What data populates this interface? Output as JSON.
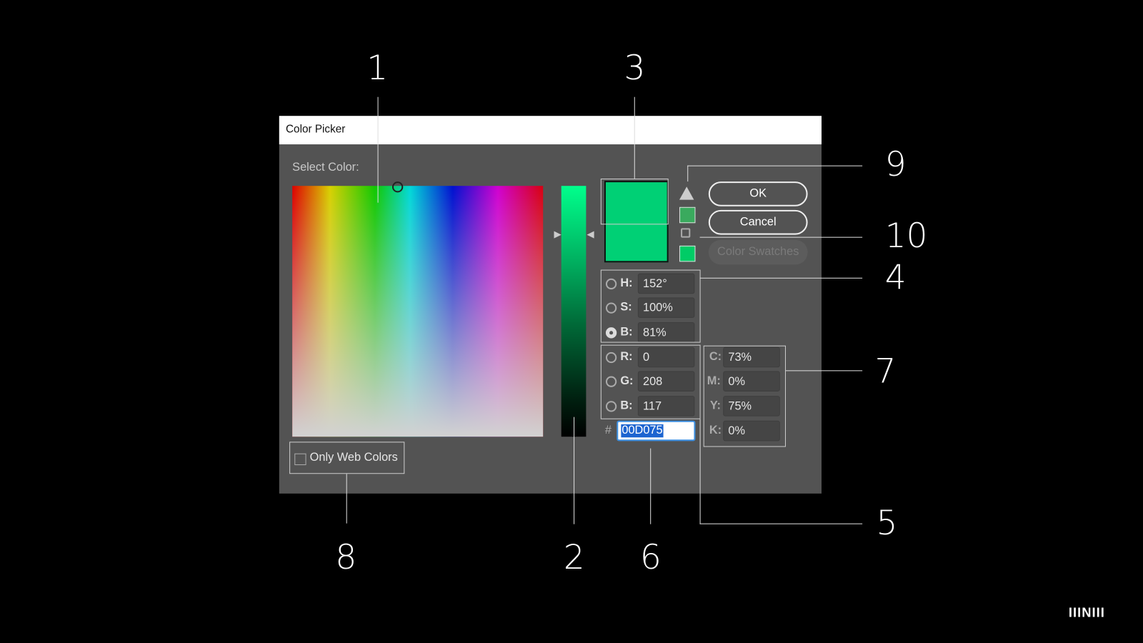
{
  "dialog": {
    "title": "Color Picker",
    "select_color_label": "Select Color:",
    "buttons": {
      "ok": "OK",
      "cancel": "Cancel",
      "color_swatches": "Color Swatches"
    },
    "only_web_colors": {
      "label": "Only Web Colors",
      "checked": false
    },
    "current_color": "#00D075",
    "new_color": "#00D075",
    "gamut_warning_swatch": "#3AAA5E",
    "web_safe_swatch": "#00CC66",
    "icons": {
      "gamut_warning": "warning-triangle-icon",
      "web_safe": "cube-icon"
    },
    "hsb": [
      {
        "label": "H:",
        "value": "152°",
        "selected": false
      },
      {
        "label": "S:",
        "value": "100%",
        "selected": false
      },
      {
        "label": "B:",
        "value": "81%",
        "selected": true
      }
    ],
    "rgb": [
      {
        "label": "R:",
        "value": "0",
        "selected": false
      },
      {
        "label": "G:",
        "value": "208",
        "selected": false
      },
      {
        "label": "B:",
        "value": "117",
        "selected": false
      }
    ],
    "hex": {
      "label": "#",
      "value": "00D075"
    },
    "cmyk": [
      {
        "label": "C:",
        "value": "73%"
      },
      {
        "label": "M:",
        "value": "0%"
      },
      {
        "label": "Y:",
        "value": "75%"
      },
      {
        "label": "K:",
        "value": "0%"
      }
    ]
  },
  "annotations": [
    "1",
    "2",
    "3",
    "4",
    "5",
    "6",
    "7",
    "8",
    "9",
    "10"
  ],
  "logo": "IIINIII"
}
